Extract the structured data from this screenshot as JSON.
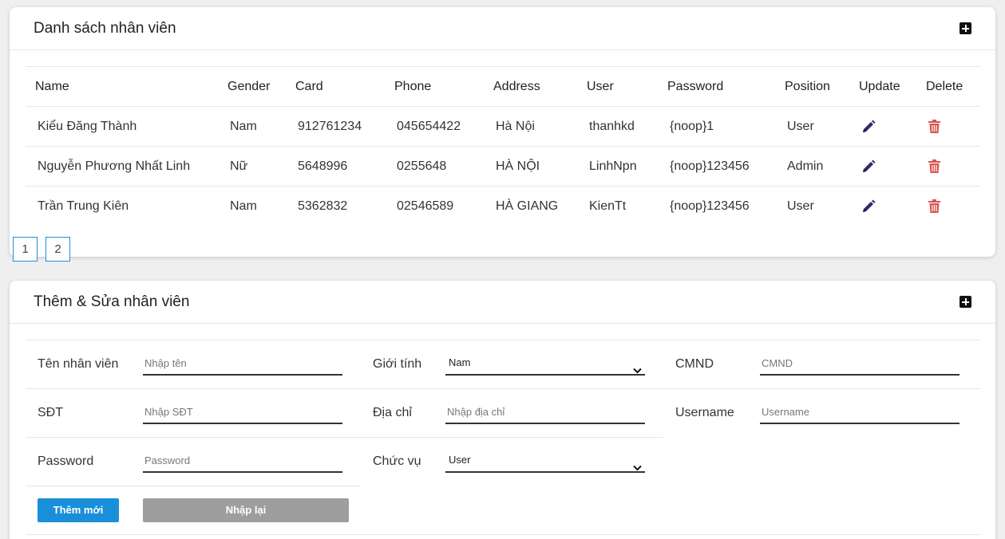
{
  "list_card": {
    "title": "Danh sách nhân viên",
    "columns": [
      "Name",
      "Gender",
      "Card",
      "Phone",
      "Address",
      "User",
      "Password",
      "Position",
      "Update",
      "Delete"
    ],
    "rows": [
      {
        "name": "Kiểu Đăng Thành",
        "gender": "Nam",
        "card": "912761234",
        "phone": "045654422",
        "address": "Hà Nội",
        "user": "thanhkd",
        "password": "{noop}1",
        "position": "User"
      },
      {
        "name": "Nguyễn Phương Nhất Linh",
        "gender": "Nữ",
        "card": "5648996",
        "phone": "0255648",
        "address": "HÀ NỘI",
        "user": "LinhNpn",
        "password": "{noop}123456",
        "position": "Admin"
      },
      {
        "name": "Trần Trung Kiên",
        "gender": "Nam",
        "card": "5362832",
        "phone": "02546589",
        "address": "HÀ GIANG",
        "user": "KienTt",
        "password": "{noop}123456",
        "position": "User"
      }
    ],
    "pages": [
      "1",
      "2"
    ]
  },
  "form_card": {
    "title": "Thêm & Sửa nhân viên",
    "fields": {
      "name": {
        "label": "Tên nhân viên",
        "placeholder": "Nhập tên"
      },
      "gender": {
        "label": "Giới tính",
        "value": "Nam"
      },
      "cmnd": {
        "label": "CMND",
        "placeholder": "CMND"
      },
      "phone": {
        "label": "SĐT",
        "placeholder": "Nhập SĐT"
      },
      "address": {
        "label": "Địa chỉ",
        "placeholder": "Nhập địa chỉ"
      },
      "username": {
        "label": "Username",
        "placeholder": "Username"
      },
      "password": {
        "label": "Password",
        "placeholder": "Password"
      },
      "position": {
        "label": "Chức vụ",
        "value": "User"
      }
    },
    "add_button": "Thêm mới",
    "reset_button": "Nhập lại"
  },
  "colors": {
    "accent": "#1a8fd9",
    "edit_icon": "#2c2c6e",
    "delete_icon": "#d9534f",
    "reset_button": "#9e9e9e"
  }
}
